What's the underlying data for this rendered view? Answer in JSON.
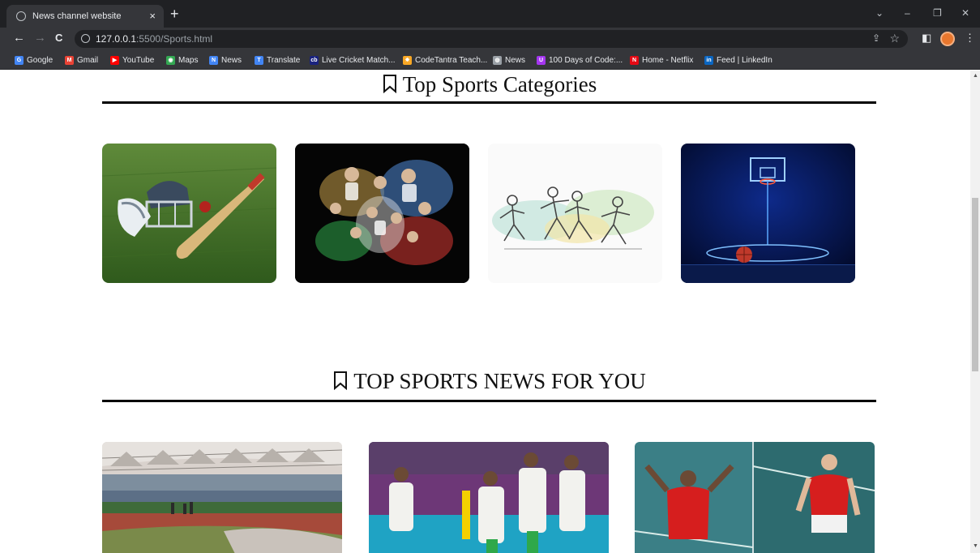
{
  "browser": {
    "tab_title": "News channel website",
    "tab_close": "×",
    "new_tab": "+",
    "url_host": "127.0.0.1",
    "url_rest": ":5500/Sports.html",
    "window_controls": {
      "minimize": "–",
      "restore": "❐",
      "close": "✕",
      "tabsearch": "⌄"
    },
    "nav": {
      "back": "←",
      "forward": "→",
      "reload": "C"
    },
    "bookmarks": [
      {
        "label": "Google",
        "icon": "google-icon",
        "color": "#4285f4"
      },
      {
        "label": "Gmail",
        "icon": "gmail-icon",
        "color": "#ea4335"
      },
      {
        "label": "YouTube",
        "icon": "youtube-icon",
        "color": "#ff0000"
      },
      {
        "label": "Maps",
        "icon": "maps-icon",
        "color": "#34a853"
      },
      {
        "label": "News",
        "icon": "google-news-icon",
        "color": "#4285f4"
      },
      {
        "label": "Translate",
        "icon": "translate-icon",
        "color": "#4285f4"
      },
      {
        "label": "Live Cricket Match...",
        "icon": "cricket-icon",
        "color": "#1a237e"
      },
      {
        "label": "CodeTantra Teach...",
        "icon": "codetantra-icon",
        "color": "#f9a825"
      },
      {
        "label": "News",
        "icon": "globe-icon",
        "color": "#9aa0a6"
      },
      {
        "label": "100 Days of Code:...",
        "icon": "udemy-icon",
        "color": "#a435f0"
      },
      {
        "label": "Home - Netflix",
        "icon": "netflix-icon",
        "color": "#e50914"
      },
      {
        "label": "Feed | LinkedIn",
        "icon": "linkedin-icon",
        "color": "#0a66c2"
      }
    ]
  },
  "page": {
    "categories_title": "Top Sports Categories",
    "news_title": "TOP SPORTS NEWS FOR YOU",
    "categories": [
      {
        "name": "cricket",
        "icon": "cricket-image"
      },
      {
        "name": "football",
        "icon": "football-image"
      },
      {
        "name": "kabaddi",
        "icon": "kabaddi-image"
      },
      {
        "name": "basketball",
        "icon": "basketball-image"
      }
    ],
    "news": [
      {
        "name": "stadium",
        "icon": "stadium-image"
      },
      {
        "name": "football-team",
        "icon": "football-team-image"
      },
      {
        "name": "tennis",
        "icon": "tennis-image"
      }
    ]
  }
}
